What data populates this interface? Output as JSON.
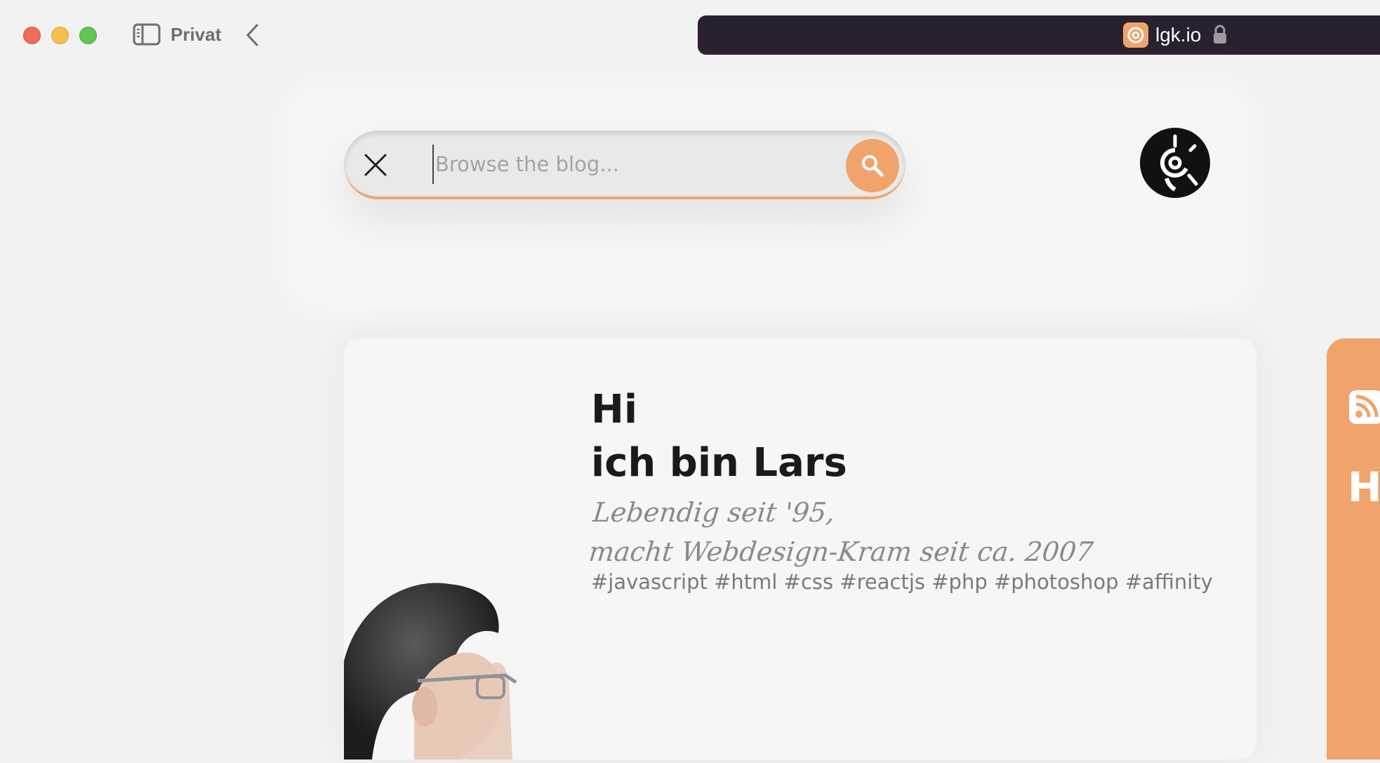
{
  "browser": {
    "profile": "Privat",
    "url": "lgk.io"
  },
  "search": {
    "placeholder": "Browse the blog..."
  },
  "hero": {
    "greeting_line1": "Hi",
    "greeting_line2": "ich bin Lars",
    "tagline_line1": "Lebendig seit '95,",
    "tagline_line2": "macht Webdesign-Kram seit ca. 2007",
    "tags": "#javascript #html #css #reactjs #php #photoshop #affinity"
  },
  "side_panel": {
    "letter": "H"
  },
  "colors": {
    "accent": "#f0a46b",
    "urlbar": "#2a2130",
    "logo": "#111111"
  },
  "icons": [
    "sidebar-toggle-icon",
    "back-chevron-icon",
    "lock-icon",
    "close-icon",
    "search-icon",
    "rss-icon"
  ]
}
